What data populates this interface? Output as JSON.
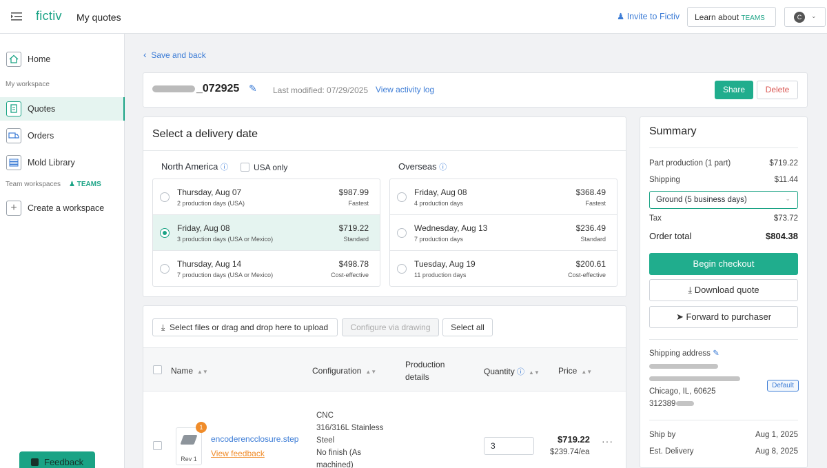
{
  "header": {
    "logo": "fictiv",
    "page_title": "My quotes",
    "invite": "Invite to Fictiv",
    "learn_about": "Learn about",
    "teams_tag": "TEAMS",
    "avatar_initial": "C"
  },
  "sidebar": {
    "home": "Home",
    "my_workspace": "My workspace",
    "quotes": "Quotes",
    "orders": "Orders",
    "mold_library": "Mold Library",
    "team_workspaces": "Team workspaces",
    "teams_tag": "TEAMS",
    "create_workspace": "Create a workspace",
    "feedback": "Feedback"
  },
  "quote": {
    "save_back": "Save and back",
    "name": "_072925",
    "last_modified": "Last modified: 07/29/2025",
    "activity_log": "View activity log",
    "share": "Share",
    "delete": "Delete"
  },
  "delivery": {
    "title": "Select a delivery date",
    "na_label": "North America",
    "usa_only": "USA only",
    "overseas_label": "Overseas",
    "na_options": [
      {
        "date": "Thursday, Aug 07",
        "days": "2 production days (USA)",
        "price": "$987.99",
        "tag": "Fastest"
      },
      {
        "date": "Friday, Aug 08",
        "days": "3 production days (USA or Mexico)",
        "price": "$719.22",
        "tag": "Standard"
      },
      {
        "date": "Thursday, Aug 14",
        "days": "7 production days (USA or Mexico)",
        "price": "$498.78",
        "tag": "Cost-effective"
      }
    ],
    "os_options": [
      {
        "date": "Friday, Aug 08",
        "days": "4 production days",
        "price": "$368.49",
        "tag": "Fastest"
      },
      {
        "date": "Wednesday, Aug 13",
        "days": "7 production days",
        "price": "$236.49",
        "tag": "Standard"
      },
      {
        "date": "Tuesday, Aug 19",
        "days": "11 production days",
        "price": "$200.61",
        "tag": "Cost-effective"
      }
    ]
  },
  "parts": {
    "upload": "Select files or drag and drop here to upload",
    "configure": "Configure via drawing",
    "select_all": "Select all",
    "columns": {
      "name": "Name",
      "configuration": "Configuration",
      "production": "Production details",
      "quantity": "Quantity",
      "price": "Price"
    },
    "row": {
      "badge": "1",
      "rev": "Rev 1",
      "file": "encoderencclosure.step",
      "feedback": "View feedback",
      "config": "CNC",
      "config2": "316/316L Stainless",
      "config3": "Steel",
      "config4": "No finish (As",
      "config5": "machined)",
      "quantity": "3",
      "price": "$719.22",
      "each": "$239.74/ea"
    }
  },
  "summary": {
    "title": "Summary",
    "part_production": "Part production (1 part)",
    "part_price": "$719.22",
    "shipping": "Shipping",
    "shipping_price": "$11.44",
    "shipping_method": "Ground (5 business days)",
    "tax": "Tax",
    "tax_price": "$73.72",
    "order_total": "Order total",
    "total_price": "$804.38",
    "checkout": "Begin checkout",
    "download": "Download quote",
    "forward": "Forward to purchaser",
    "address_label": "Shipping address",
    "default": "Default",
    "city": "Chicago, IL, 60625",
    "phone": "312389",
    "ship_by": "Ship by",
    "ship_by_date": "Aug 1, 2025",
    "est_delivery": "Est. Delivery",
    "est_delivery_date": "Aug 8, 2025"
  },
  "colors": {
    "accent": "#1aa385",
    "link": "#3c7cd6",
    "danger": "#d9534f"
  }
}
